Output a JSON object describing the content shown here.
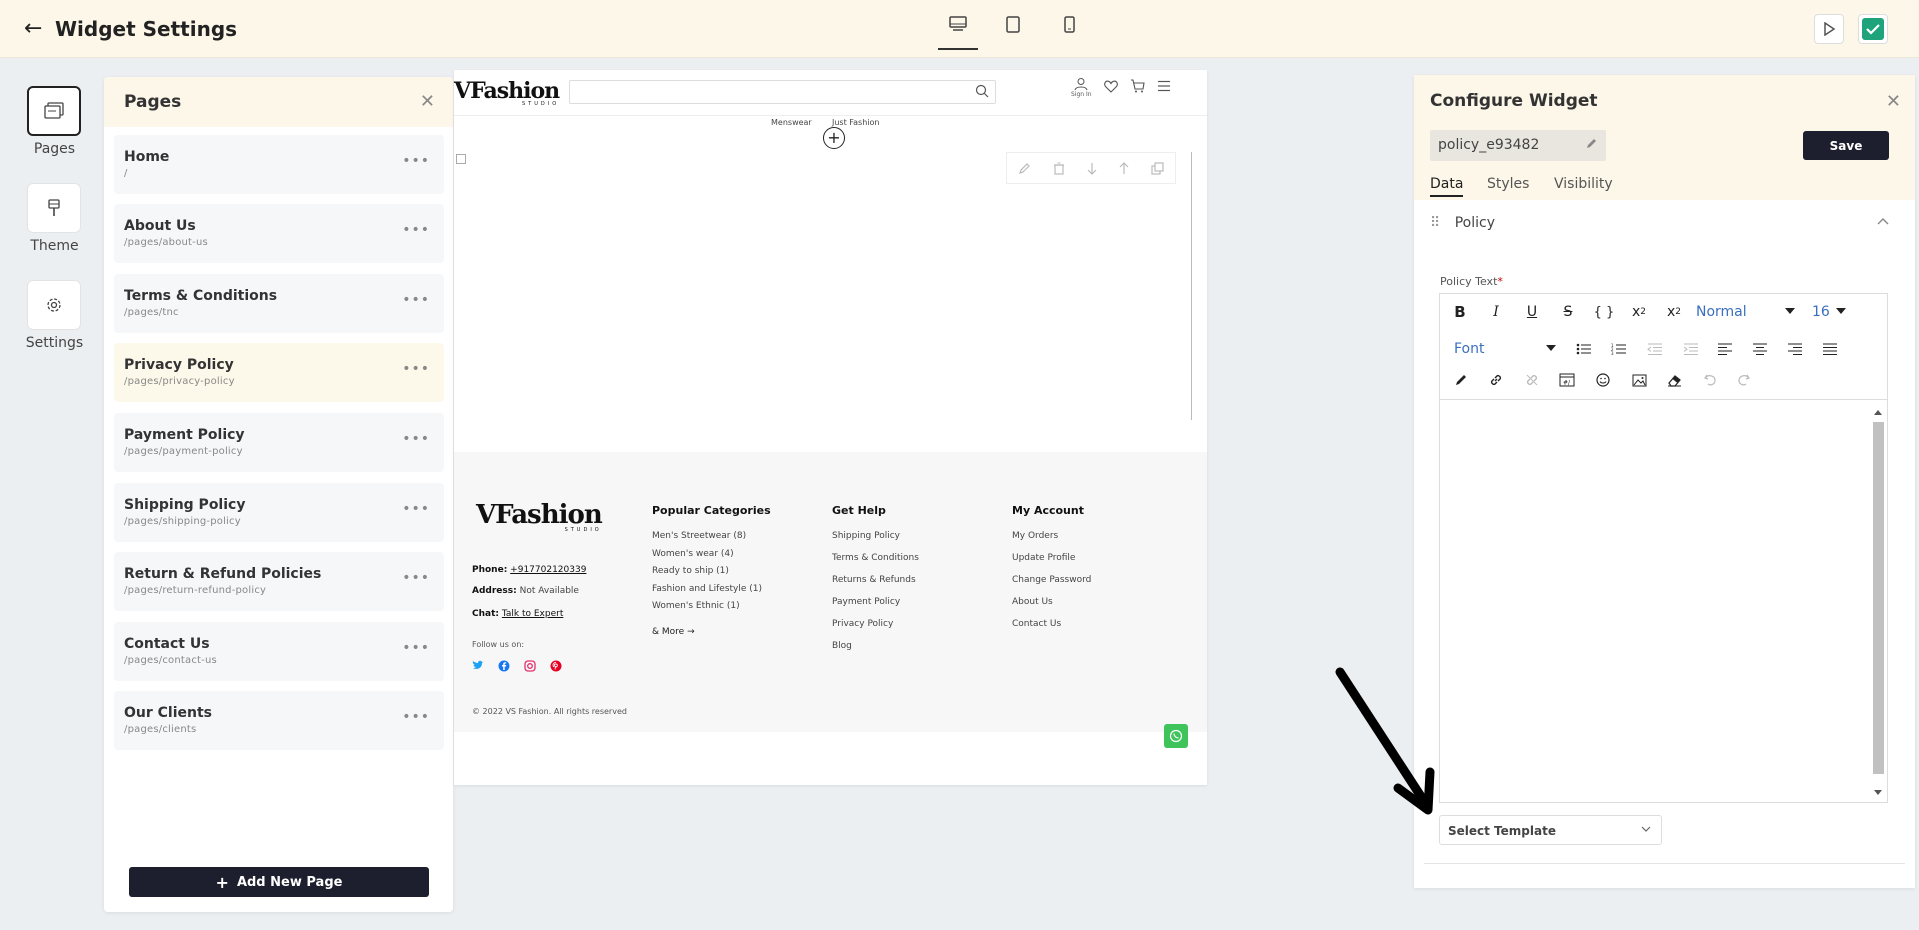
{
  "topbar": {
    "title": "Widget Settings"
  },
  "rail": [
    {
      "label": "Pages"
    },
    {
      "label": "Theme"
    },
    {
      "label": "Settings"
    }
  ],
  "pages_panel": {
    "title": "Pages",
    "items": [
      {
        "name": "Home",
        "path": "/"
      },
      {
        "name": "About Us",
        "path": "/pages/about-us"
      },
      {
        "name": "Terms & Conditions",
        "path": "/pages/tnc"
      },
      {
        "name": "Privacy Policy",
        "path": "/pages/privacy-policy"
      },
      {
        "name": "Payment Policy",
        "path": "/pages/payment-policy"
      },
      {
        "name": "Shipping Policy",
        "path": "/pages/shipping-policy"
      },
      {
        "name": "Return & Refund Policies",
        "path": "/pages/return-refund-policy"
      },
      {
        "name": "Contact Us",
        "path": "/pages/contact-us"
      },
      {
        "name": "Our Clients",
        "path": "/pages/clients"
      }
    ],
    "add_button": "Add New Page"
  },
  "preview": {
    "logo": "VFashion",
    "logo_sub": "STUDIO",
    "signin": "Sign In",
    "nav": [
      "Menswear",
      "Just Fashion"
    ],
    "footer": {
      "phone_label": "Phone:",
      "phone": "+917702120339",
      "address_label": "Address:",
      "address": "Not Available",
      "chat_label": "Chat:",
      "chat": "Talk to Expert",
      "follow": "Follow us on:",
      "columns": [
        {
          "heading": "Popular Categories",
          "links": [
            "Men's Streetwear (8)",
            "Women's wear (4)",
            "Ready to ship (1)",
            "Fashion and Lifestyle (1)",
            "Women's Ethnic (1)"
          ],
          "more": "& More"
        },
        {
          "heading": "Get Help",
          "links": [
            "Shipping Policy",
            "Terms & Conditions",
            "Returns & Refunds",
            "Payment Policy",
            "Privacy Policy",
            "Blog"
          ]
        },
        {
          "heading": "My Account",
          "links": [
            "My Orders",
            "Update Profile",
            "Change Password",
            "About Us",
            "Contact Us"
          ]
        }
      ],
      "copyright": "© 2022 VS Fashion. All rights reserved"
    }
  },
  "configure": {
    "title": "Configure Widget",
    "widget_name": "policy_e93482",
    "save": "Save",
    "tabs": [
      "Data",
      "Styles",
      "Visibility"
    ],
    "section": "Policy",
    "field_label": "Policy Text",
    "required_mark": "*",
    "format_select": "Normal",
    "size_select": "16",
    "font_select": "Font",
    "template_placeholder": "Select Template"
  }
}
